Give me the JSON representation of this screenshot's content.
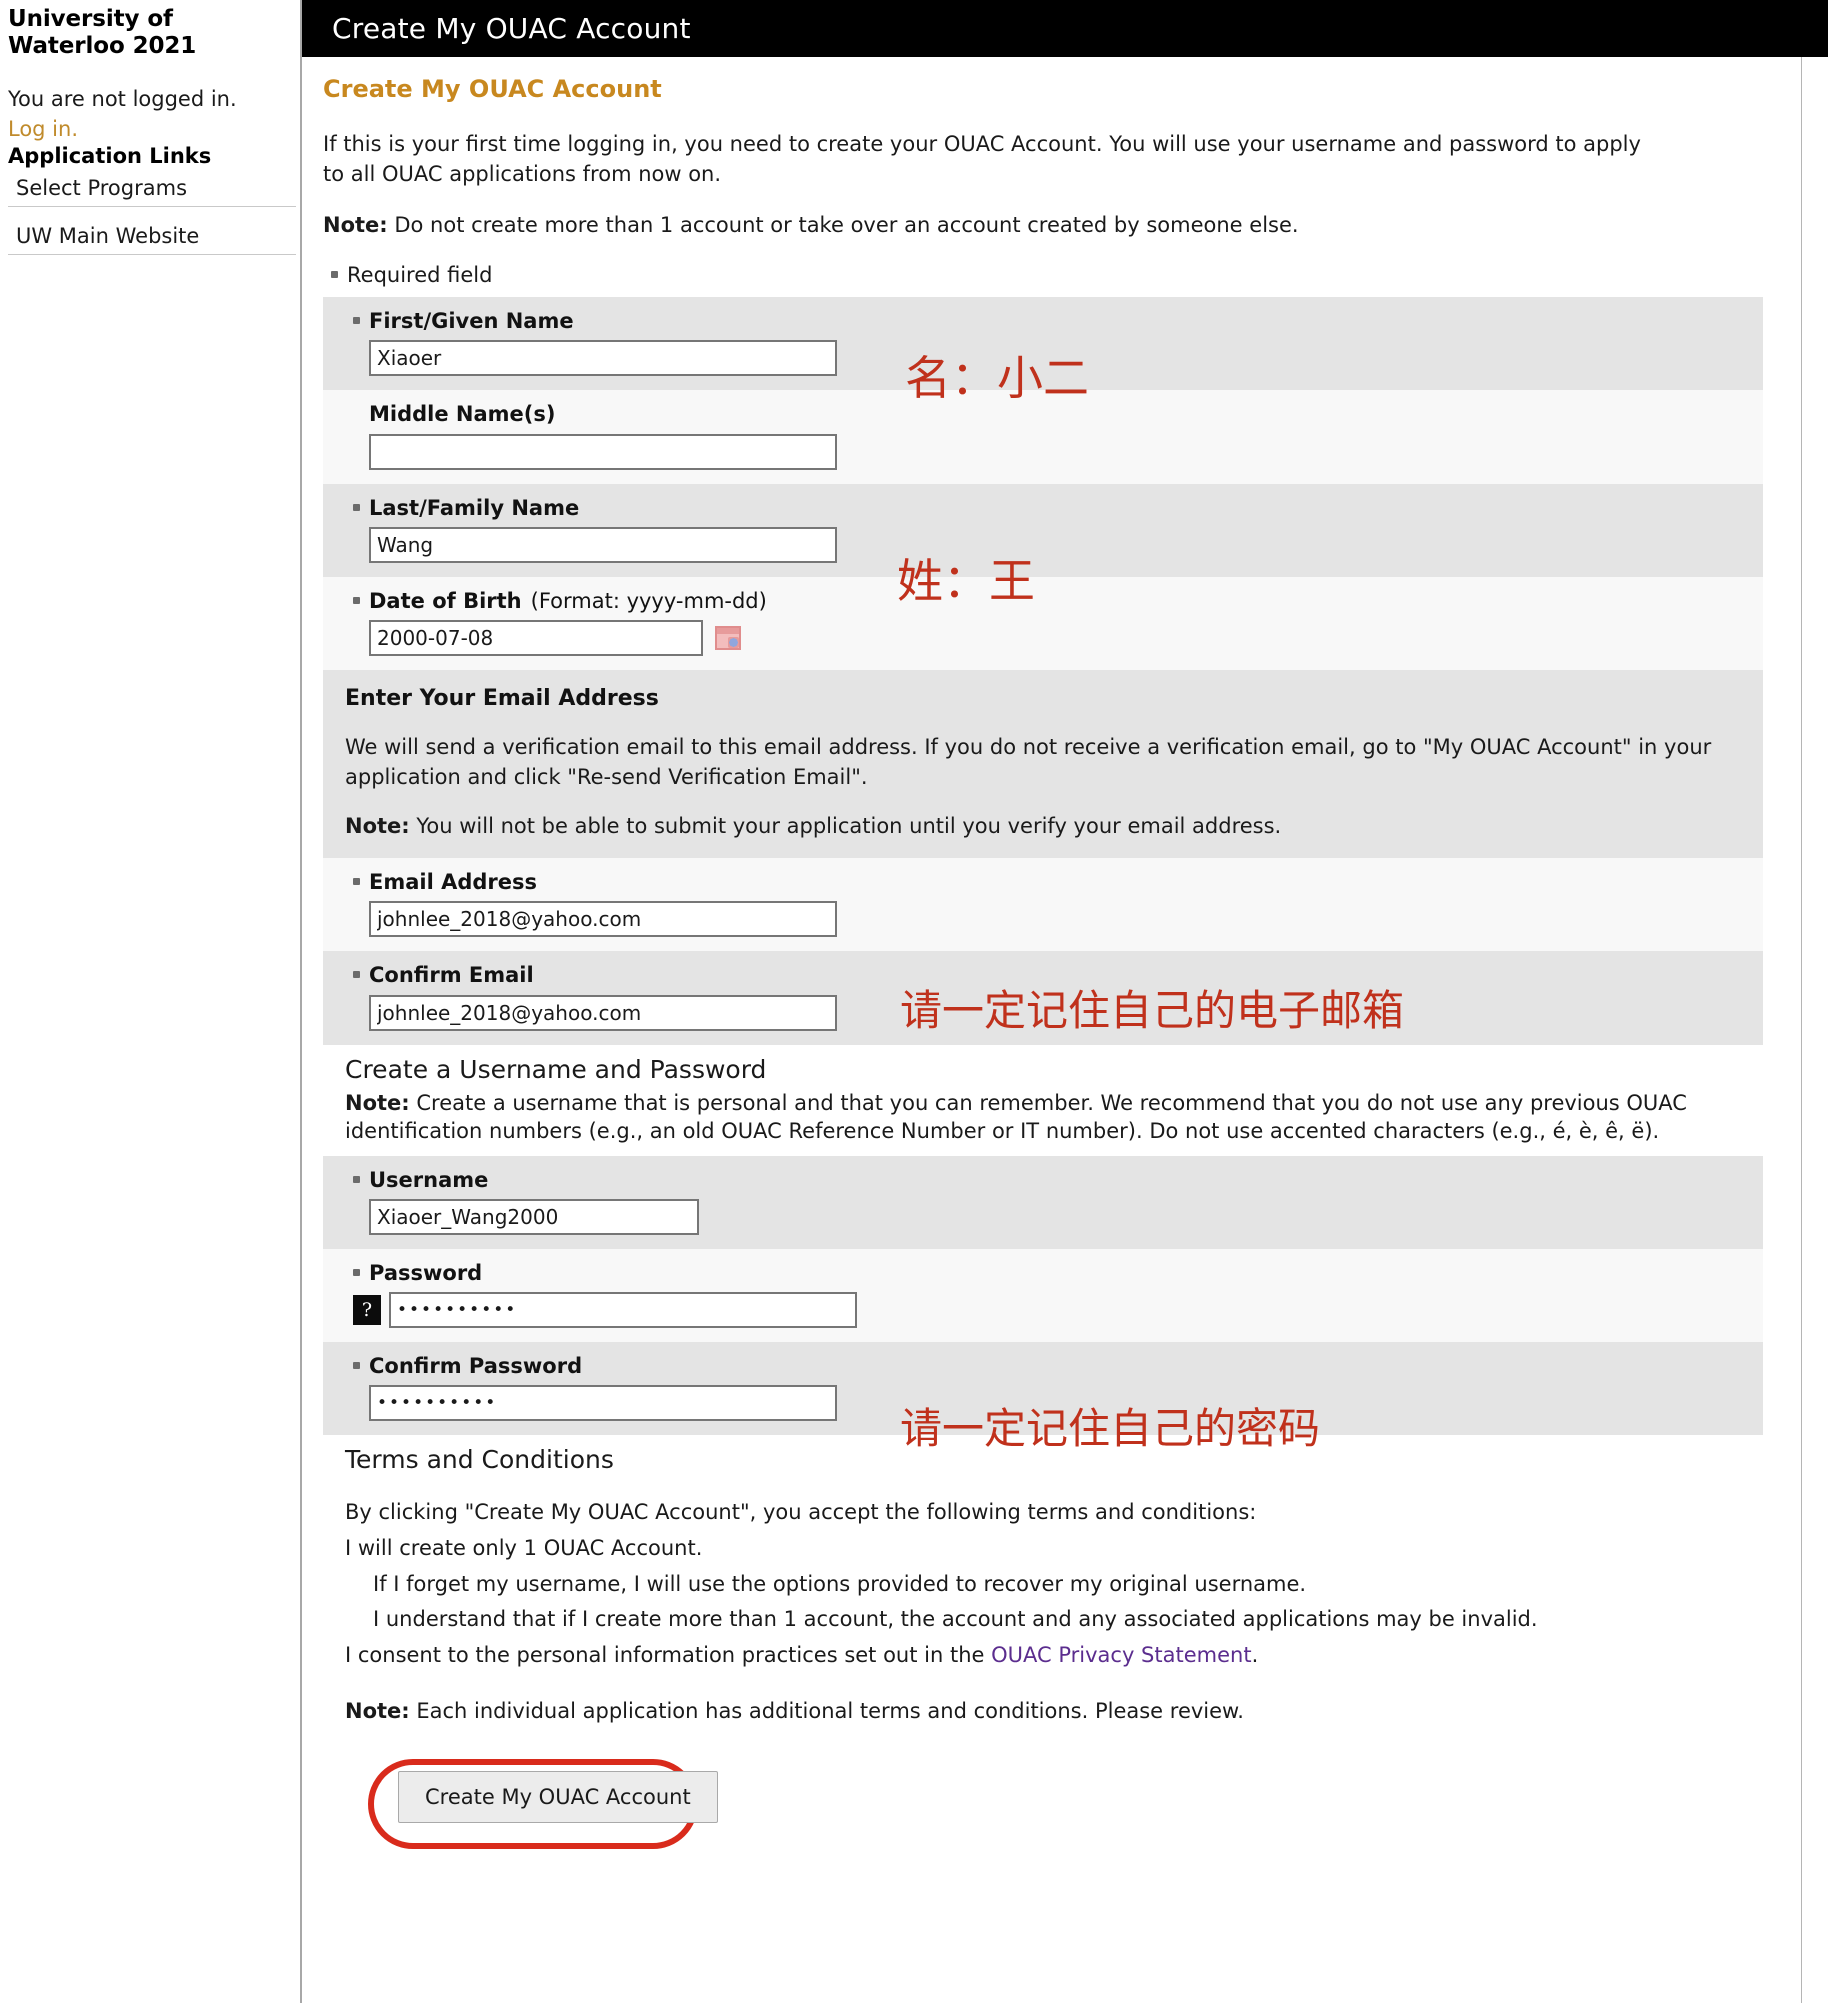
{
  "sidebar": {
    "site_title": "University of\nWaterloo 2021",
    "login_status": "You are not logged in.",
    "login_link": "Log in.",
    "section_heading": "Application Links",
    "links": [
      {
        "label": "Select Programs"
      },
      {
        "label": "UW Main Website"
      }
    ]
  },
  "titlebar": {
    "title": "Create My OUAC Account"
  },
  "page": {
    "heading": "Create My OUAC Account",
    "intro": "If this is your first time logging in, you need to create your OUAC Account. You will use your username and password to apply to all OUAC applications from now on.",
    "note_label": "Note:",
    "note_text": " Do not create more than 1 account or take over an account created by someone else.",
    "required_field_legend": "Required field"
  },
  "fields": {
    "first_name": {
      "label": "First/Given Name",
      "value": "Xiaoer",
      "required": true
    },
    "middle_name": {
      "label": "Middle Name(s)",
      "value": "",
      "required": false
    },
    "last_name": {
      "label": "Last/Family Name",
      "value": "Wang",
      "required": true
    },
    "dob": {
      "label": "Date of Birth",
      "format_hint": "(Format: yyyy-mm-dd)",
      "value": "2000-07-08",
      "required": true,
      "icon": "calendar-icon"
    },
    "email": {
      "label": "Email Address",
      "value": "johnlee_2018@yahoo.com",
      "required": true
    },
    "confirm_email": {
      "label": "Confirm Email",
      "value": "johnlee_2018@yahoo.com",
      "required": true
    },
    "username": {
      "label": "Username",
      "value": "Xiaoer_Wang2000",
      "required": true
    },
    "password": {
      "label": "Password",
      "value": "••••••••••",
      "required": true,
      "help_icon": "?"
    },
    "confirm_password": {
      "label": "Confirm Password",
      "value": "••••••••••",
      "required": true
    }
  },
  "email_section": {
    "heading": "Enter Your Email Address",
    "paragraph": "We will send a verification email to this email address. If you do not receive a verification email, go to \"My OUAC Account\" in your application and click \"Re-send Verification Email\".",
    "note_label": "Note:",
    "note_text": " You will not be able to submit your application until you verify your email address."
  },
  "username_section": {
    "heading": "Create a Username and Password",
    "note_label": "Note:",
    "note_text": " Create a username that is personal and that you can remember. We recommend that you do not use any previous OUAC identification numbers (e.g., an old OUAC Reference Number or IT number). Do not use accented characters (e.g., é, è, ê, ë)."
  },
  "terms_section": {
    "heading": "Terms and Conditions",
    "lead": "By clicking \"Create My OUAC Account\", you accept the following terms and conditions:",
    "lines": [
      {
        "text": "I will create only 1 OUAC Account.",
        "indent": false
      },
      {
        "text": "If I forget my username, I will use the options provided to recover my original username.",
        "indent": true
      },
      {
        "text": "I understand that if I create more than 1 account, the account and any associated applications may be invalid.",
        "indent": true
      }
    ],
    "consent_prefix": "I consent to the personal information practices set out in the ",
    "consent_link": "OUAC Privacy Statement",
    "consent_suffix": ".",
    "note_label": "Note:",
    "note_text": " Each individual application has additional terms and conditions. Please review."
  },
  "submit": {
    "label": "Create My OUAC Account"
  },
  "annotations": {
    "first_name_cn": "名：小二",
    "last_name_cn": "姓：王",
    "email_cn": "请一定记住自己的电子邮箱",
    "password_cn": "请一定记住自己的密码"
  },
  "colors": {
    "titlebar_bg": "#000000",
    "heading_accent": "#c8881f",
    "annotation_red": "#c0311c",
    "highlight_oval": "#d92b1c",
    "link_purple": "#5b2d8e",
    "sidebar_login_link": "#c08b2c",
    "row_shade": "#e4e4e4",
    "row_light": "#f8f8f8"
  }
}
